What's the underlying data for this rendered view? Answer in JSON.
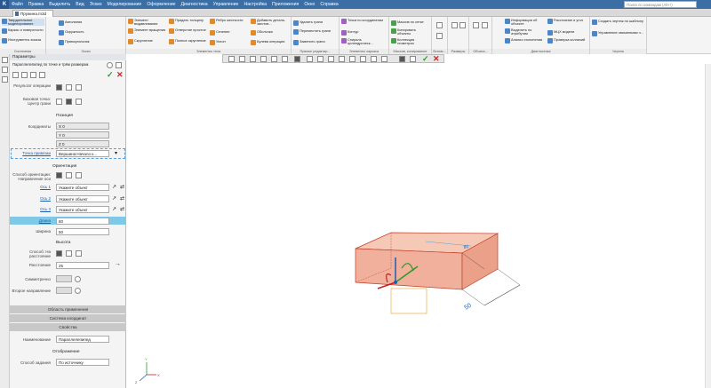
{
  "menubar": {
    "items": [
      "Файл",
      "Правка",
      "Выделить",
      "Вид",
      "Эскиз",
      "Моделирование",
      "Оформление",
      "Диагностика",
      "Управление",
      "Настройка",
      "Приложения",
      "Окно",
      "Справка"
    ],
    "search_placeholder": "Поиск по командам (Alt+/)"
  },
  "tab": {
    "title": "Пружина.m3d"
  },
  "ribbon": {
    "groups": [
      {
        "title": "Системная",
        "items": [
          "Твердотельное моделирование",
          "Каркас и поверхности",
          "Инструменты эскиза"
        ]
      },
      {
        "title": "Эскиз",
        "items": [
          "Автолиния",
          "Окружность",
          "Прямоугольник"
        ]
      },
      {
        "title": "Элементы тела",
        "items": [
          "Элемент выдавливания",
          "Элемент вращения",
          "Скругление",
          "Придать толщину",
          "Отверстие простое",
          "Полное скругление",
          "Ребро жесткости",
          "Сечение",
          "Уклон",
          "Добавить деталь-заготов...",
          "Оболочка",
          "Булева операция"
        ]
      },
      {
        "title": "Прямое редактир...",
        "items": [
          "Удалить грани",
          "Переместить грани",
          "Заменить грани"
        ]
      },
      {
        "title": "Элементы каркаса",
        "items": [
          "Точка по координатам",
          "Контур",
          "Спираль цилиндрическ..."
        ]
      },
      {
        "title": "Массив, копирование",
        "items": [
          "Массив по сетке",
          "Копировать объекты",
          "Коллекция геометрии"
        ]
      },
      {
        "title": "Вспом...",
        "items": []
      },
      {
        "title": "Размеры",
        "items": []
      },
      {
        "title": "Обозна...",
        "items": []
      },
      {
        "title": "Диагностика",
        "items": [
          "Информация об объекте",
          "Выделить по атрибутам",
          "Анализ отклонения",
          "Расстояние и угол",
          "МЦХ модели",
          "Проверка коллизий"
        ]
      },
      {
        "title": "Чертеж",
        "items": [
          "Создать чертеж по шаблону",
          "Управление связанными ч..."
        ]
      }
    ]
  },
  "panel": {
    "header": "Параметры",
    "subtitle": "Параллелепипед по точке и трём размерам",
    "result_label": "Результат операции",
    "base_point_label": "Базовая точка: Центр грани",
    "position_title": "Позиция",
    "coords_label": "Координаты",
    "x": {
      "name": "X",
      "value": "0"
    },
    "y": {
      "name": "Y",
      "value": "0"
    },
    "z": {
      "name": "Z",
      "value": "0"
    },
    "binding_point_link": "Точка привязки",
    "binding_point_value": "Вершина:Начало к...",
    "orientation_title": "Ориентация",
    "orientation_method_label": "Способ ориентации: Направление оси",
    "axis1_label": "Ось 1",
    "axis1_value": "Укажите объект",
    "axis2_label": "Ось 2",
    "axis2_value": "Укажите объект",
    "axis3_label": "Ось 3",
    "axis3_value": "Укажите объект",
    "length_label": "Длина",
    "length_value": "80",
    "width_label": "Ширина",
    "width_value": "50",
    "height_title": "Высота",
    "height_method_label": "Способ: На расстояние",
    "distance_label": "Расстояние",
    "distance_value": "25",
    "symmetric_label": "Симметрично",
    "second_dir_label": "Второе направление",
    "sections": [
      "Область применения",
      "Система координат",
      "Свойства"
    ],
    "name_label": "Наименование",
    "name_value": "Параллелепипед",
    "display_title": "Отображение",
    "display_method_label": "Способ задания",
    "display_method_value": "По источнику"
  },
  "canvas": {
    "dim_length": "80",
    "dim_width": "50",
    "axis_labels": {
      "x": "X",
      "y": "Y",
      "z": "Z"
    }
  }
}
